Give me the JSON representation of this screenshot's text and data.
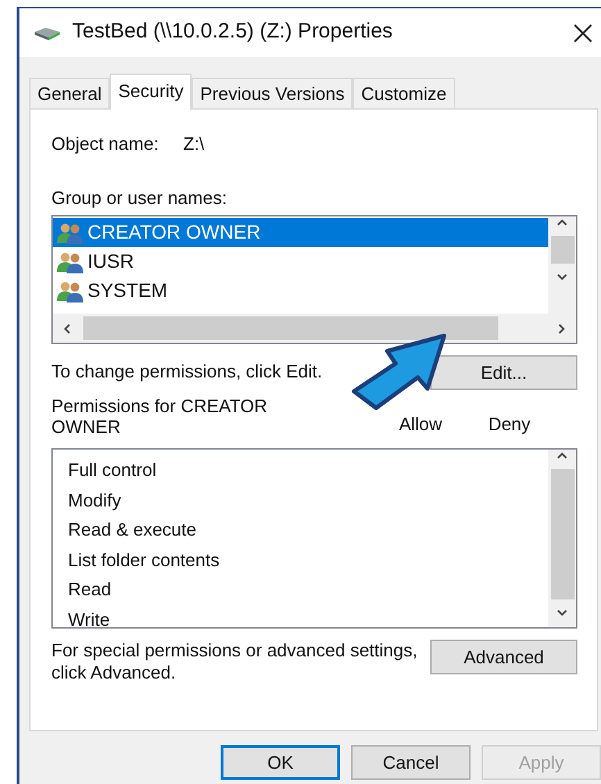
{
  "window": {
    "title": "TestBed (\\\\10.0.2.5) (Z:) Properties"
  },
  "tabs": [
    {
      "label": "General",
      "selected": false
    },
    {
      "label": "Security",
      "selected": true
    },
    {
      "label": "Previous Versions",
      "selected": false
    },
    {
      "label": "Customize",
      "selected": false
    }
  ],
  "object_name": {
    "label": "Object name:",
    "value": "Z:\\"
  },
  "group_label": "Group or user names:",
  "users": [
    {
      "name": "CREATOR OWNER",
      "selected": true
    },
    {
      "name": "IUSR",
      "selected": false
    },
    {
      "name": "SYSTEM",
      "selected": false
    }
  ],
  "edit_hint": "To change permissions, click Edit.",
  "edit_button": "Edit...",
  "permissions": {
    "title": "Permissions for CREATOR OWNER",
    "columns": [
      "Allow",
      "Deny"
    ],
    "rows": [
      "Full control",
      "Modify",
      "Read & execute",
      "List folder contents",
      "Read",
      "Write"
    ]
  },
  "advanced_hint": "For special permissions or advanced settings, click Advanced.",
  "advanced_button": "Advanced",
  "buttons": [
    {
      "label": "OK",
      "default": true,
      "disabled": false
    },
    {
      "label": "Cancel",
      "default": false,
      "disabled": false
    },
    {
      "label": "Apply",
      "default": false,
      "disabled": true
    }
  ]
}
